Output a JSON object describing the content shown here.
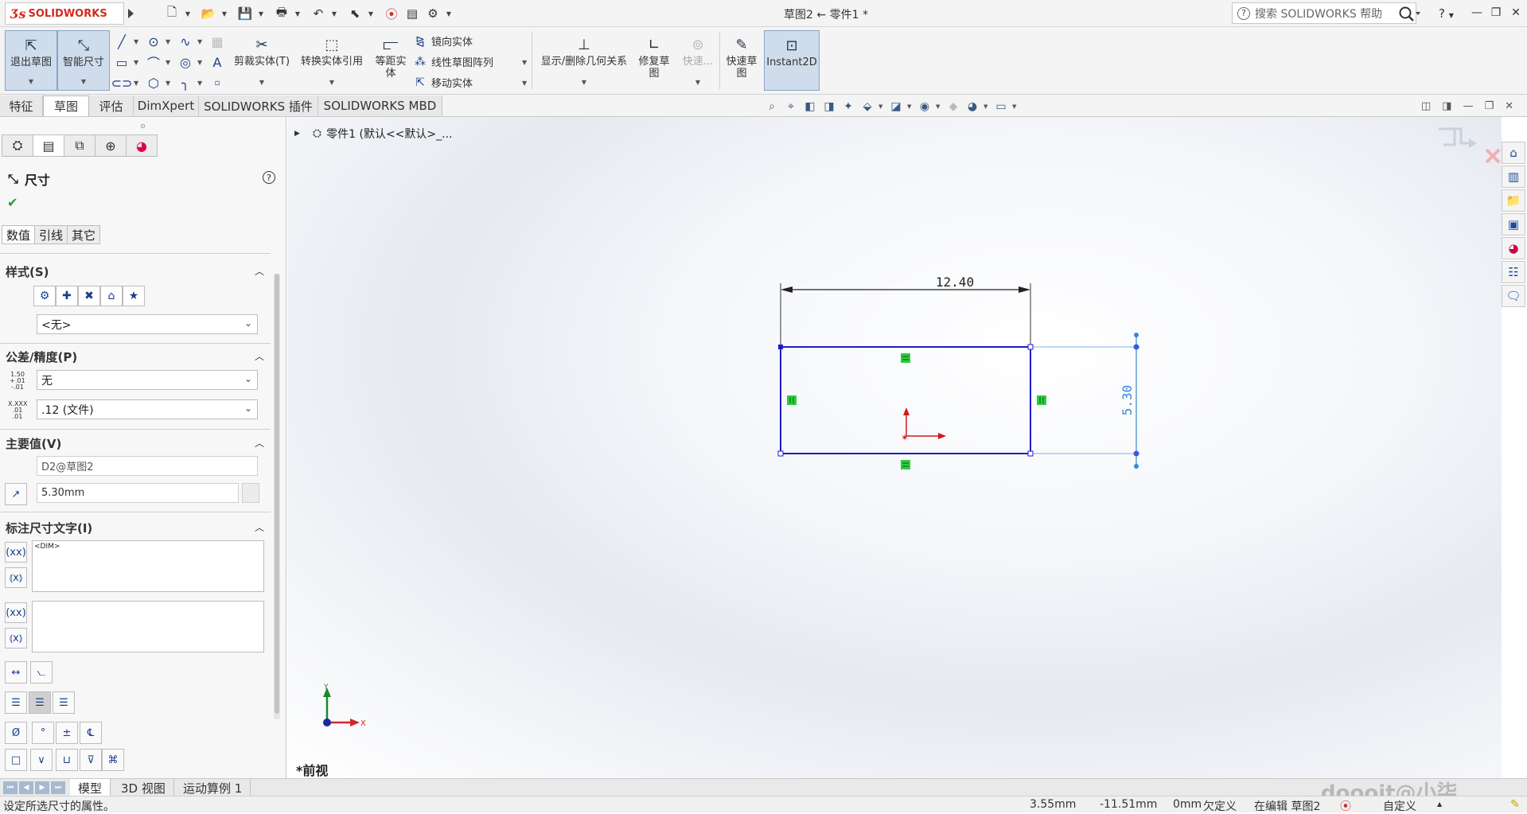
{
  "app": {
    "brand": "SOLIDWORKS",
    "doc_title": "草图2 ← 零件1 *"
  },
  "search": {
    "placeholder": "搜索 SOLIDWORKS 帮助",
    "help_label": "?"
  },
  "command_manager": {
    "exit_sketch": "退出草图",
    "smart_dimension": "智能尺寸",
    "trim": "剪裁实体(T)",
    "convert": "转换实体引用",
    "offset": "等距实体",
    "mirror": "镜向实体",
    "linear_pattern": "线性草图阵列",
    "move": "移动实体",
    "show_relations": "显示/删除几何关系",
    "repair": "修复草图",
    "quick_snaps": "快速...",
    "rapid_sketch": "快速草图",
    "instant2d": "Instant2D"
  },
  "tabs": [
    "特征",
    "草图",
    "评估",
    "DimXpert",
    "SOLIDWORKS 插件",
    "SOLIDWORKS MBD"
  ],
  "active_tab": "草图",
  "property_manager": {
    "title": "尺寸",
    "subtabs": [
      "数值",
      "引线",
      "其它"
    ],
    "style": {
      "title": "样式(S)",
      "combo": "<无>"
    },
    "tolerance": {
      "title": "公差/精度(P)",
      "tol_type": "无",
      "precision": ".12 (文件)",
      "tol_icon_text": "1.50 +.01 -.01",
      "prec_icon_text": "X.XXX .01 .01"
    },
    "primary": {
      "title": "主要值(V)",
      "name": "D2@草图2",
      "value": "5.30mm"
    },
    "dim_text": {
      "title": "标注尺寸文字(I)",
      "text": "<DIM>"
    }
  },
  "tree": {
    "item": "零件1  (默认<<默认>_..."
  },
  "sketch": {
    "horizontal_dim": "12.40",
    "vertical_dim": "5.30"
  },
  "triad": {
    "x": "X",
    "y": "Y"
  },
  "view_label": "*前视",
  "bottom_tabs": [
    "模型",
    "3D 视图",
    "运动算例 1"
  ],
  "status": {
    "message": "设定所选尺寸的属性。",
    "x": "3.55mm",
    "y": "-11.51mm",
    "z": "0mm",
    "defined": "欠定义",
    "editing": "在编辑 草图2",
    "units": "自定义"
  },
  "watermark": "doooit@小柒",
  "colors": {
    "sketch_blue": "#1c1cc8",
    "dim_blue": "#3a86d8",
    "relation_green": "#2ecc40",
    "origin_red": "#d01818",
    "brand_red": "#d52b1e"
  }
}
